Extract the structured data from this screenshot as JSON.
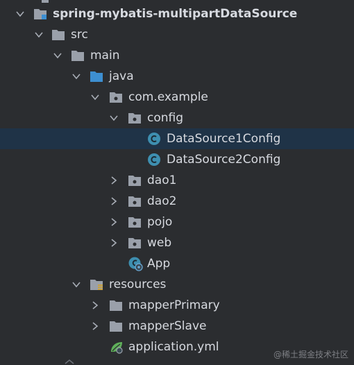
{
  "tree": {
    "project": "spring-mybatis-multipartDataSource",
    "src": "src",
    "main": "main",
    "java": "java",
    "package": "com.example",
    "config": "config",
    "class1": "DataSource1Config",
    "class2": "DataSource2Config",
    "dao1": "dao1",
    "dao2": "dao2",
    "pojo": "pojo",
    "web": "web",
    "app": "App",
    "resources": "resources",
    "mapperPrimary": "mapperPrimary",
    "mapperSlave": "mapperSlave",
    "appYml": "application.yml"
  },
  "watermark": "@稀土掘金技术社区",
  "colors": {
    "background": "#2b2d30",
    "selection": "#1f3347",
    "folder": "#9aa0aa",
    "sourceFolder": "#3d8fd1",
    "classIcon": "#3e8fb0",
    "text": "#d7dae0"
  },
  "icons": {
    "expanded": "chevron-down-icon",
    "collapsed": "chevron-right-icon",
    "folder": "folder-icon",
    "package": "package-icon",
    "class": "class-icon",
    "app": "spring-boot-app-icon",
    "yml": "spring-config-icon"
  }
}
